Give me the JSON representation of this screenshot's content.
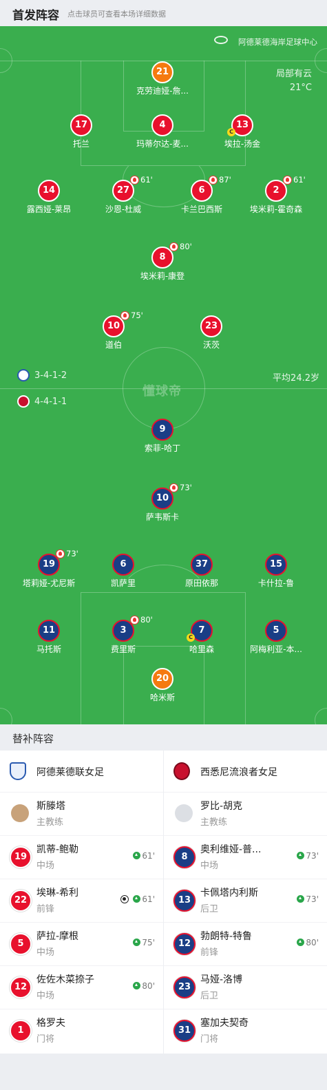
{
  "header": {
    "title": "首发阵容",
    "hint": "点击球员可查看本场详细数据"
  },
  "pitch": {
    "venue": "阿德莱德海岸足球中心",
    "weather": "局部有云",
    "temp": "21°C",
    "home_formation": "3-4-1-2",
    "away_formation": "4-4-1-1",
    "avg_age": "平均24.2岁",
    "watermark": "懂球帝",
    "home": [
      {
        "num": "21",
        "name": "克劳迪娅-詹...",
        "kind": "org"
      },
      {
        "num": "17",
        "name": "托兰",
        "kind": "red"
      },
      {
        "num": "4",
        "name": "玛蒂尔达-麦...",
        "kind": "red"
      },
      {
        "num": "13",
        "name": "埃拉-汤金",
        "kind": "red",
        "captain": true
      },
      {
        "num": "14",
        "name": "露西娅-莱昂",
        "kind": "red"
      },
      {
        "num": "27",
        "name": "沙恩-杜威",
        "kind": "red",
        "sub": "61'"
      },
      {
        "num": "6",
        "name": "卡兰巴西斯",
        "kind": "red",
        "sub": "87'"
      },
      {
        "num": "2",
        "name": "埃米莉-霍奇森",
        "kind": "red",
        "sub": "61'"
      },
      {
        "num": "8",
        "name": "埃米莉-康登",
        "kind": "red",
        "sub": "80'"
      },
      {
        "num": "10",
        "name": "道伯",
        "kind": "red",
        "sub": "75'"
      },
      {
        "num": "23",
        "name": "沃茨",
        "kind": "red"
      }
    ],
    "away": [
      {
        "num": "9",
        "name": "索菲-哈丁",
        "kind": "blu"
      },
      {
        "num": "10",
        "name": "萨韦斯卡",
        "kind": "blu",
        "sub": "73'"
      },
      {
        "num": "19",
        "name": "塔莉娅-尤尼斯",
        "kind": "blu",
        "sub": "73'"
      },
      {
        "num": "6",
        "name": "凯萨里",
        "kind": "blu"
      },
      {
        "num": "37",
        "name": "原田依那",
        "kind": "blu"
      },
      {
        "num": "15",
        "name": "卡什拉-鲁",
        "kind": "blu"
      },
      {
        "num": "11",
        "name": "马托斯",
        "kind": "blu"
      },
      {
        "num": "3",
        "name": "费里斯",
        "kind": "blu",
        "sub": "80'"
      },
      {
        "num": "7",
        "name": "哈里森",
        "kind": "blu",
        "captain": true
      },
      {
        "num": "5",
        "name": "阿梅利亚-本...",
        "kind": "blu"
      },
      {
        "num": "20",
        "name": "哈米斯",
        "kind": "org"
      }
    ]
  },
  "bench": {
    "title": "替补阵容",
    "home_team": "阿德莱德联女足",
    "away_team": "西悉尼流浪者女足",
    "home_coach": {
      "name": "斯滕塔",
      "role": "主教练"
    },
    "away_coach": {
      "name": "罗比-胡克",
      "role": "主教练"
    },
    "home": [
      {
        "num": "19",
        "name": "凯蒂-鲍勒",
        "pos": "中场",
        "in": "61'"
      },
      {
        "num": "22",
        "name": "埃琳-希利",
        "pos": "前锋",
        "in": "61'",
        "goal": true
      },
      {
        "num": "5",
        "name": "萨拉-摩根",
        "pos": "中场",
        "in": "75'"
      },
      {
        "num": "12",
        "name": "佐佐木菜捺子",
        "pos": "中场",
        "in": "80'"
      },
      {
        "num": "1",
        "name": "格罗夫",
        "pos": "门将"
      }
    ],
    "away": [
      {
        "num": "8",
        "name": "奥利维娅-普...",
        "pos": "中场",
        "in": "73'"
      },
      {
        "num": "13",
        "name": "卡佩塔内利斯",
        "pos": "后卫",
        "in": "73'"
      },
      {
        "num": "12",
        "name": "勃朗特-特鲁",
        "pos": "前锋",
        "in": "80'"
      },
      {
        "num": "23",
        "name": "马娅-洛博",
        "pos": "后卫"
      },
      {
        "num": "31",
        "name": "塞加夫契奇",
        "pos": "门将"
      }
    ]
  }
}
